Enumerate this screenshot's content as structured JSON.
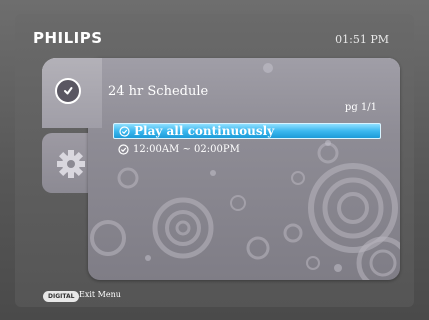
{
  "header": {
    "brand": "PHILIPS",
    "time": "01:51 PM"
  },
  "schedule": {
    "title": "24 hr Schedule",
    "page": "pg 1/1",
    "items": [
      {
        "label": "Play all continuously",
        "selected": true
      },
      {
        "label": "12:00AM ~ 02:00PM",
        "selected": false
      }
    ]
  },
  "footer": {
    "badge": "DIGITAL",
    "label": "Exit Menu"
  },
  "icons": {
    "schedule_tab": "clock-icon",
    "settings_tab": "gear-icon",
    "item": "clock-icon"
  },
  "colors": {
    "selection": "#3cb8ef",
    "panel": "#8e8c95"
  }
}
